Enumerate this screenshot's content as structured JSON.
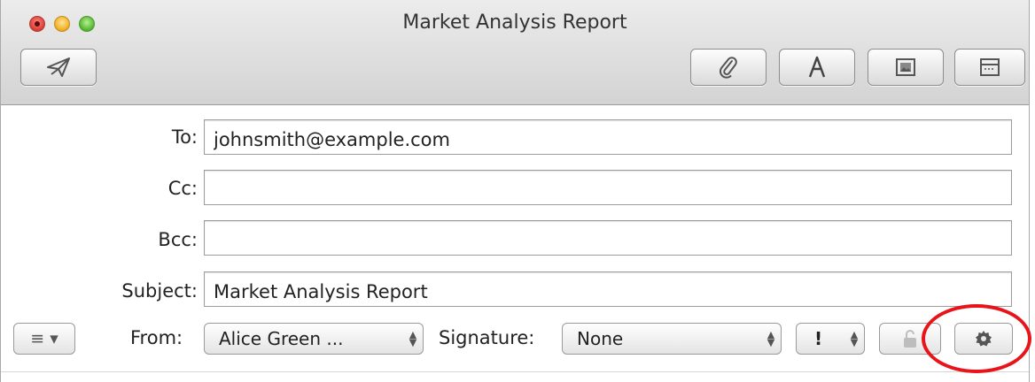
{
  "window": {
    "title": "Market Analysis Report"
  },
  "toolbar": {
    "send_icon": "paper-plane-icon",
    "attach_icon": "paperclip-icon",
    "format_icon": "font-A-icon",
    "photo_icon": "photo-browser-icon",
    "template_icon": "stationery-icon"
  },
  "headers": {
    "to_label": "To:",
    "to_value": "johnsmith@example.com",
    "cc_label": "Cc:",
    "cc_value": "",
    "bcc_label": "Bcc:",
    "bcc_value": "",
    "subject_label": "Subject:",
    "subject_value": "Market Analysis Report"
  },
  "options_bar": {
    "list_button": "≡ ▾",
    "from_label": "From:",
    "from_value": "Alice Green ...",
    "signature_label": "Signature:",
    "signature_value": "None",
    "priority_value": "!",
    "lock_icon": "lock-icon",
    "gear_icon": "gear-icon"
  },
  "colors": {
    "annotation": "#e8141a",
    "toolbar_bg": "#d3d3d3"
  }
}
